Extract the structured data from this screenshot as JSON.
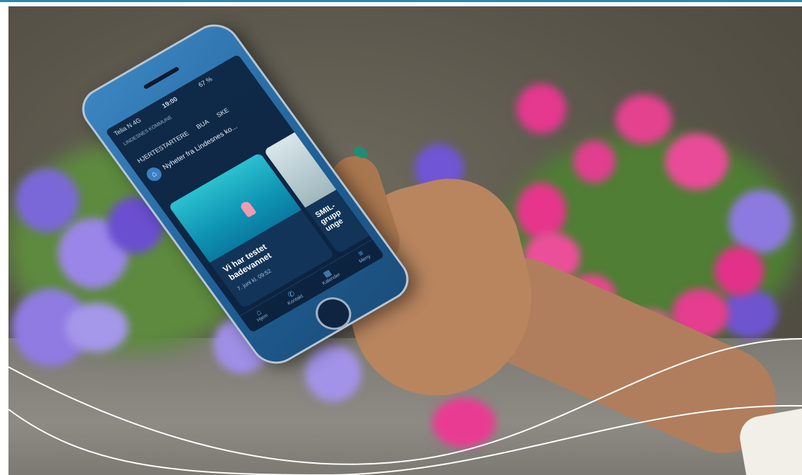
{
  "phone_screen": {
    "status": {
      "carrier": "Telia N  4G",
      "time": "19:00",
      "battery": "67 %"
    },
    "brand": "LINDESNES\nKOMMUNE",
    "tabs": [
      "HJERTESTARTERE",
      "BUA",
      "SKE"
    ],
    "search_title": "Nyheter fra Lindesnes ko...",
    "section_heading": "Nyheter fra Lindesnes ko...",
    "card1": {
      "title": "Vi har testet badevannet",
      "date": "7. juni kl. 09:52"
    },
    "card2": {
      "title": "SMIL-grupp unge"
    },
    "nav": [
      {
        "label": "Hjem",
        "icon": "home-icon"
      },
      {
        "label": "Kontakt",
        "icon": "phone-icon"
      },
      {
        "label": "Kalender",
        "icon": "calendar-icon"
      },
      {
        "label": "Meny",
        "icon": "menu-icon"
      }
    ]
  },
  "colors": {
    "accent_line": "#2a8aa8",
    "phone_case": "#2f78b5",
    "screen_bg": "#0f2a48",
    "flower_purple": "#8b74e0",
    "flower_pink": "#e8318a"
  }
}
